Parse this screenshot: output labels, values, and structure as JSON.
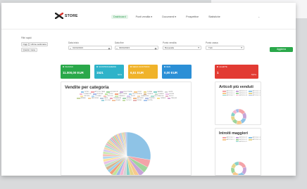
{
  "app": {
    "logo_text": "STORE"
  },
  "nav": {
    "items": [
      {
        "label": "Dashboard",
        "active": true
      },
      {
        "label": "Punti vendita ▾",
        "active": false
      },
      {
        "label": "Documenti ▾",
        "active": false
      },
      {
        "label": "Prospettive",
        "active": false
      },
      {
        "label": "Statistiche",
        "active": false
      }
    ],
    "end": "⌄"
  },
  "filters": {
    "quick_label": "Filtri rapidi",
    "quick": [
      "Oggi",
      "Ultime settimana",
      "Questo mese"
    ],
    "from_label": "Data inizio",
    "from_value": "01/04/2023",
    "to_label": "Data fine",
    "to_value": "30/04/2023",
    "store_label": "Punto vendita",
    "store_value": "Bonavalle",
    "cash_label": "Punto cassa",
    "cash_value": "Tutti",
    "apply_label": "Aggiorna"
  },
  "kpis": [
    {
      "title": "INCASSO",
      "value": "11.000,00 EUR",
      "right": "",
      "color": "#2aa84a"
    },
    {
      "title": "SCONTRINI EMESSI",
      "value": "1521",
      "right": "kpi ▸",
      "color": "#2fb3c9"
    },
    {
      "title": "MEDIA SCONTRINO",
      "value": "6,51 EUR",
      "right": "",
      "color": "#f0b32a"
    },
    {
      "title": "RESI",
      "value": "0,00 EUR",
      "right": "",
      "color": "#2b8fd6"
    },
    {
      "title": "ALLERTE",
      "value": "1",
      "right": "Apri ▸",
      "color": "#e23b33"
    }
  ],
  "sales_by_category": {
    "title": "Vendite per categoria",
    "categories": [
      {
        "name": "INTIMO",
        "color": "#8ec3e6"
      },
      {
        "name": "ARTICOLI CASA",
        "color": "#f4a3a8"
      },
      {
        "name": "ACCESSORI",
        "color": "#9fd59b"
      },
      {
        "name": "BIGIOTTERIA",
        "color": "#c7a4d8"
      },
      {
        "name": "UOMO",
        "color": "#f7c98b"
      },
      {
        "name": "DONNA",
        "color": "#e6d58a"
      },
      {
        "name": "BAMBINI",
        "color": "#87d1c9"
      },
      {
        "name": "CALZE",
        "color": "#d3d3d3"
      },
      {
        "name": "COSMETICA",
        "color": "#f5b6d0"
      },
      {
        "name": "PROFUMI",
        "color": "#a7b8e8"
      },
      {
        "name": "GIOCHI",
        "color": "#bfe39d"
      },
      {
        "name": "CARTOLERIA",
        "color": "#f2a07b"
      },
      {
        "name": "ELETTRONICA",
        "color": "#9ad0e8"
      },
      {
        "name": "TESSILE",
        "color": "#d9b48f"
      },
      {
        "name": "SCARPE",
        "color": "#c2e0c6"
      },
      {
        "name": "BORSE",
        "color": "#e9c2e8"
      },
      {
        "name": "CINTURE",
        "color": "#fbe3a2"
      },
      {
        "name": "OCCHIALI",
        "color": "#b3d9f2"
      },
      {
        "name": "OROLOGI",
        "color": "#f8c0b5"
      },
      {
        "name": "OMBRELLI",
        "color": "#cbe8b0"
      },
      {
        "name": "SPORT",
        "color": "#d6c8f0"
      },
      {
        "name": "CASALINGHI",
        "color": "#f3d7b1"
      },
      {
        "name": "DECORAZIONI",
        "color": "#a9e0d2"
      },
      {
        "name": "ALTRO",
        "color": "#e8b9c7"
      },
      {
        "name": "ANIMALI",
        "color": "#c9d6a3"
      },
      {
        "name": "MERCERIA",
        "color": "#f6cf9c"
      },
      {
        "name": "VARIE",
        "color": "#b7c7d9"
      },
      {
        "name": "PRIMAVERA",
        "color": "#eaa5b9"
      },
      {
        "name": "ESTATE",
        "color": "#a6d6b5"
      },
      {
        "name": "AUTUNNO",
        "color": "#f0b98a"
      },
      {
        "name": "INVERNO",
        "color": "#b4bfe3"
      },
      {
        "name": "NATALE",
        "color": "#f2dd8e"
      },
      {
        "name": "PASQUA",
        "color": "#d8a9d6"
      },
      {
        "name": "SCUOLA",
        "color": "#9fd4e0"
      },
      {
        "name": "REGALI",
        "color": "#f4c4a1"
      },
      {
        "name": "OUTLET",
        "color": "#c6dfa8"
      },
      {
        "name": "PROMO",
        "color": "#e7b3b3"
      },
      {
        "name": "NOVITÀ",
        "color": "#a8c6ee"
      }
    ],
    "shares": [
      0.26,
      0.05,
      0.04,
      0.035,
      0.03,
      0.03,
      0.028,
      0.026,
      0.025,
      0.024,
      0.022,
      0.021,
      0.02,
      0.02,
      0.019,
      0.018,
      0.018,
      0.017,
      0.016,
      0.016,
      0.015,
      0.015,
      0.014,
      0.014,
      0.013,
      0.013,
      0.012,
      0.012,
      0.012,
      0.011,
      0.011,
      0.01,
      0.01,
      0.01,
      0.009,
      0.009,
      0.008,
      0.008
    ]
  },
  "top_articles": {
    "title": "Articoli più venduti",
    "items": [
      {
        "name": "ARTICOLO 1",
        "color": "#f4a3a8"
      },
      {
        "name": "ARTICOLO 2",
        "color": "#c7a4d8"
      },
      {
        "name": "ARTICOLO 3",
        "color": "#8ec3e6"
      },
      {
        "name": "ARTICOLO 4",
        "color": "#f7c98b"
      },
      {
        "name": "ARTICOLO 5",
        "color": "#9fd59b"
      },
      {
        "name": "ARTICOLO 6",
        "color": "#e6d58a"
      },
      {
        "name": "ARTICOLO 7",
        "color": "#87d1c9"
      },
      {
        "name": "ARTICOLO 8",
        "color": "#f5b6d0"
      },
      {
        "name": "ARTICOLO 9",
        "color": "#a7b8e8"
      }
    ],
    "shares": [
      0.16,
      0.14,
      0.13,
      0.12,
      0.11,
      0.1,
      0.09,
      0.08,
      0.07
    ]
  },
  "top_revenue": {
    "title": "Introiti maggiori",
    "items": [
      {
        "name": "ARTICOLO 1",
        "color": "#f4a3a8"
      },
      {
        "name": "ARTICOLO 2",
        "color": "#c7a4d8"
      },
      {
        "name": "ARTICOLO 3",
        "color": "#8ec3e6"
      },
      {
        "name": "ARTICOLO 4",
        "color": "#f7c98b"
      },
      {
        "name": "ARTICOLO 5",
        "color": "#9fd59b"
      },
      {
        "name": "ARTICOLO 6",
        "color": "#e6d58a"
      },
      {
        "name": "ARTICOLO 7",
        "color": "#87d1c9"
      }
    ],
    "shares": [
      0.2,
      0.17,
      0.15,
      0.14,
      0.13,
      0.11,
      0.1
    ]
  }
}
